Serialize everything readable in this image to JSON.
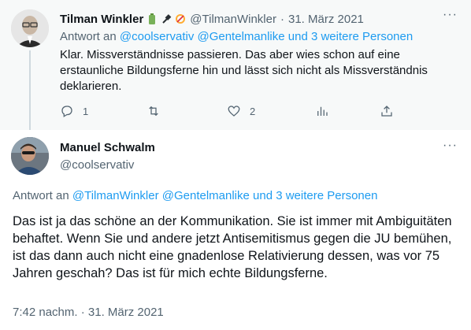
{
  "reply_tweet": {
    "author_name": "Tilman Winkler",
    "handle": "@TilmanWinkler",
    "date_separator": "·",
    "date": "31. März 2021",
    "replying_prefix": "Antwort an",
    "replying_to": "@coolservativ @Gentelmanlike und 3 weitere Personen",
    "text": "Klar. Missverständnisse passieren. Das aber wies schon auf eine erstaunliche Bildungsferne hin und lässt sich nicht als Missverständnis deklarieren.",
    "actions": {
      "reply_count": "1",
      "retweet_count": "",
      "like_count": "2"
    },
    "more_label": "···"
  },
  "main_tweet": {
    "author_name": "Manuel Schwalm",
    "handle": "@coolservativ",
    "replying_prefix": "Antwort an",
    "replying_to": "@TilmanWinkler @Gentelmanlike und 3 weitere Personen",
    "text": "Das ist ja das schöne an der Kommunikation. Sie ist immer mit Ambiguitäten behaftet. Wenn Sie und andere jetzt Antisemitismus gegen die JU bemühen, ist das dann auch nicht eine gnadenlose Relativierung dessen, was vor 75 Jahren geschah? Das ist für mich echte Bildungsferne.",
    "timestamp": "7:42 nachm. · 31. März 2021",
    "more_label": "···"
  },
  "colors": {
    "link": "#1d9bf0",
    "secondary_text": "#536471",
    "reply_background": "#f7f9f9"
  },
  "icons": [
    "battery-icon",
    "plug-icon",
    "sign-icon",
    "reply-icon",
    "retweet-icon",
    "like-icon",
    "stats-icon",
    "share-icon",
    "more-icon"
  ]
}
